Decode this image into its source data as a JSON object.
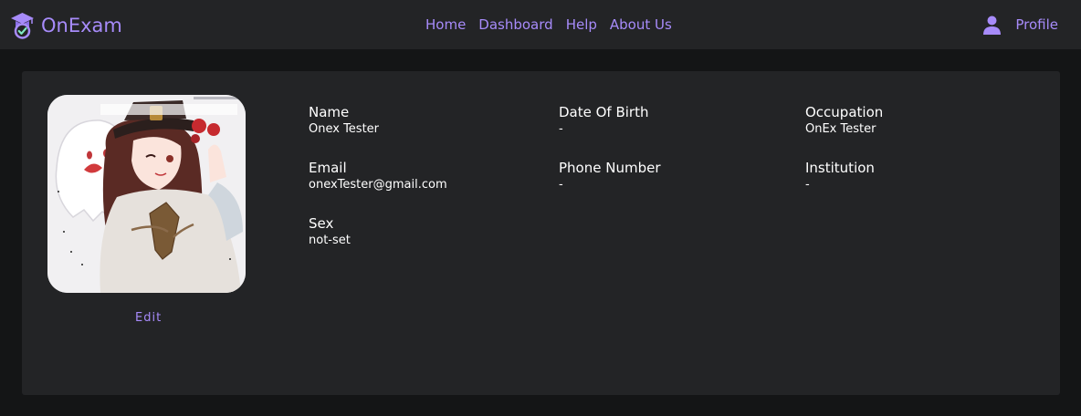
{
  "navbar": {
    "brand": "OnExam",
    "links": [
      "Home",
      "Dashboard",
      "Help",
      "About Us"
    ],
    "profile_label": "Profile"
  },
  "profile_card": {
    "edit_label": "Edit",
    "fields": [
      {
        "label": "Name",
        "value": "Onex Tester"
      },
      {
        "label": "Date Of Birth",
        "value": "-"
      },
      {
        "label": "Occupation",
        "value": "OnEx Tester"
      },
      {
        "label": "Email",
        "value": "onexTester@gmail.com"
      },
      {
        "label": "Phone Number",
        "value": "-"
      },
      {
        "label": "Institution",
        "value": "-"
      },
      {
        "label": "Sex",
        "value": "not-set"
      }
    ]
  },
  "colors": {
    "accent": "#a78bfa",
    "navbar_bg": "#232426",
    "page_bg": "#141516",
    "card_bg": "#232426"
  },
  "icons": {
    "brand": "graduation-cap-icon",
    "profile": "user-icon"
  }
}
